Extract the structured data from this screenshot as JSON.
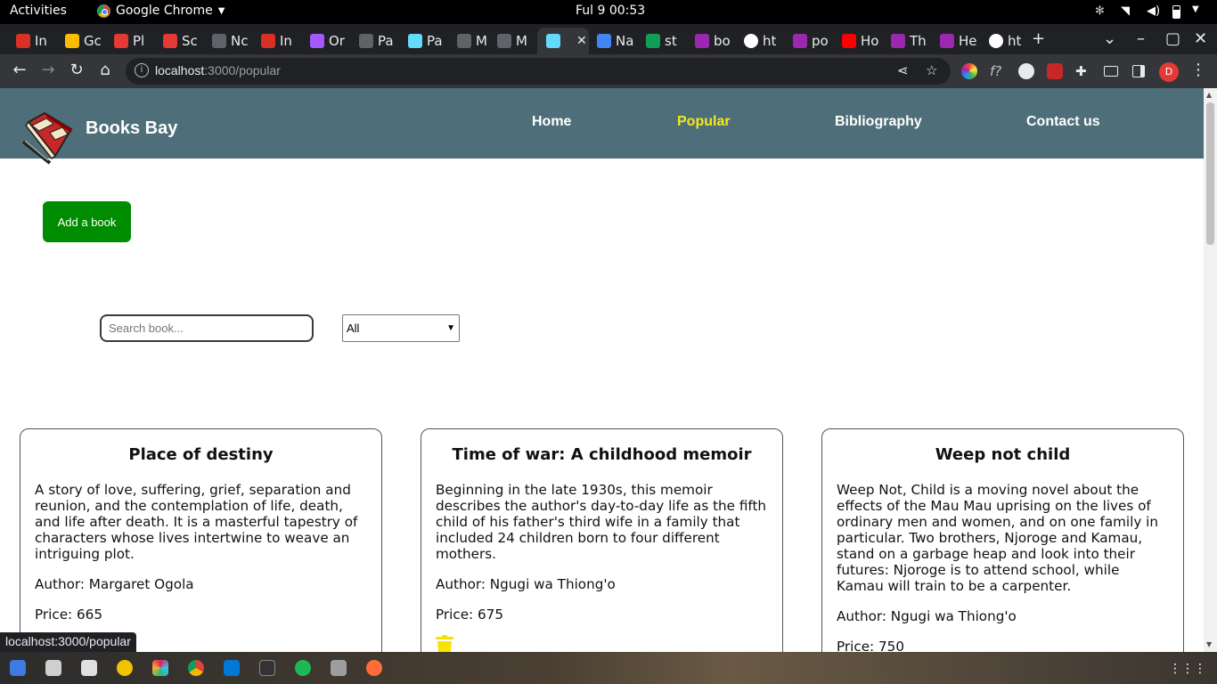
{
  "system": {
    "activities": "Activities",
    "app_name": "Google Chrome",
    "clock": "Ful 9  00:53"
  },
  "browser": {
    "tabs": [
      {
        "label": "In",
        "color": "#d93025"
      },
      {
        "label": "Gc",
        "color": "#fbbc04"
      },
      {
        "label": "Pl",
        "color": "#e53935"
      },
      {
        "label": "Sc",
        "color": "#e53935"
      },
      {
        "label": "Nc",
        "color": "#5f6368"
      },
      {
        "label": "In",
        "color": "#d93025"
      },
      {
        "label": "Or",
        "color": "#a259ff"
      },
      {
        "label": "Pa",
        "color": "#5f6368"
      },
      {
        "label": "Pa",
        "color": "#61dafb"
      },
      {
        "label": "M",
        "color": "#5f6368"
      },
      {
        "label": "M",
        "color": "#5f6368"
      },
      {
        "label": "",
        "color": "#61dafb"
      },
      {
        "label": "Na",
        "color": "#4285f4"
      },
      {
        "label": "st",
        "color": "#0f9d58"
      },
      {
        "label": "bo",
        "color": "#9c27b0"
      },
      {
        "label": "ht",
        "color": "#ffffff"
      },
      {
        "label": "po",
        "color": "#9c27b0"
      },
      {
        "label": "Ho",
        "color": "#ff0000"
      },
      {
        "label": "Th",
        "color": "#9c27b0"
      },
      {
        "label": "He",
        "color": "#9c27b0"
      },
      {
        "label": "ht",
        "color": "#ffffff"
      }
    ],
    "url_host": "localhost",
    "url_path": ":3000/popular",
    "profile_initial": "D",
    "status_url": "localhost:3000/popular"
  },
  "site": {
    "brand": "Books Bay",
    "nav": [
      {
        "label": "Home"
      },
      {
        "label": "Popular"
      },
      {
        "label": "Bibliography"
      },
      {
        "label": "Contact us"
      }
    ],
    "add_button": "Add a book",
    "search_placeholder": "Search book...",
    "filter_selected": "All",
    "books": [
      {
        "title": "Place of destiny",
        "description": "A story of love, suffering, grief, separation and reunion, and the contemplation of life, death, and life after death. It is a masterful tapestry of characters whose lives intertwine to weave an intriguing plot.",
        "author": "Author: Margaret Ogola",
        "price": "Price: 665"
      },
      {
        "title": "Time of war: A childhood memoir",
        "description": "Beginning in the late 1930s, this memoir describes the author's day-to-day life as the fifth child of his father's third wife in a family that included 24 children born to four different mothers.",
        "author": "Author: Ngugi wa Thiong'o",
        "price": "Price: 675"
      },
      {
        "title": "Weep not child",
        "description": "Weep Not, Child is a moving novel about the effects of the Mau Mau uprising on the lives of ordinary men and women, and on one family in particular. Two brothers, Njoroge and Kamau, stand on a garbage heap and look into their futures: Njoroge is to attend school, while Kamau will train to be a carpenter.",
        "author": "Author: Ngugi wa Thiong'o",
        "price": "Price: 750"
      }
    ]
  },
  "colors": {
    "navbar": "#4e6f79",
    "active_nav": "#f5e91a",
    "add_button": "#008c00",
    "trash_icon": "#f5e400"
  }
}
